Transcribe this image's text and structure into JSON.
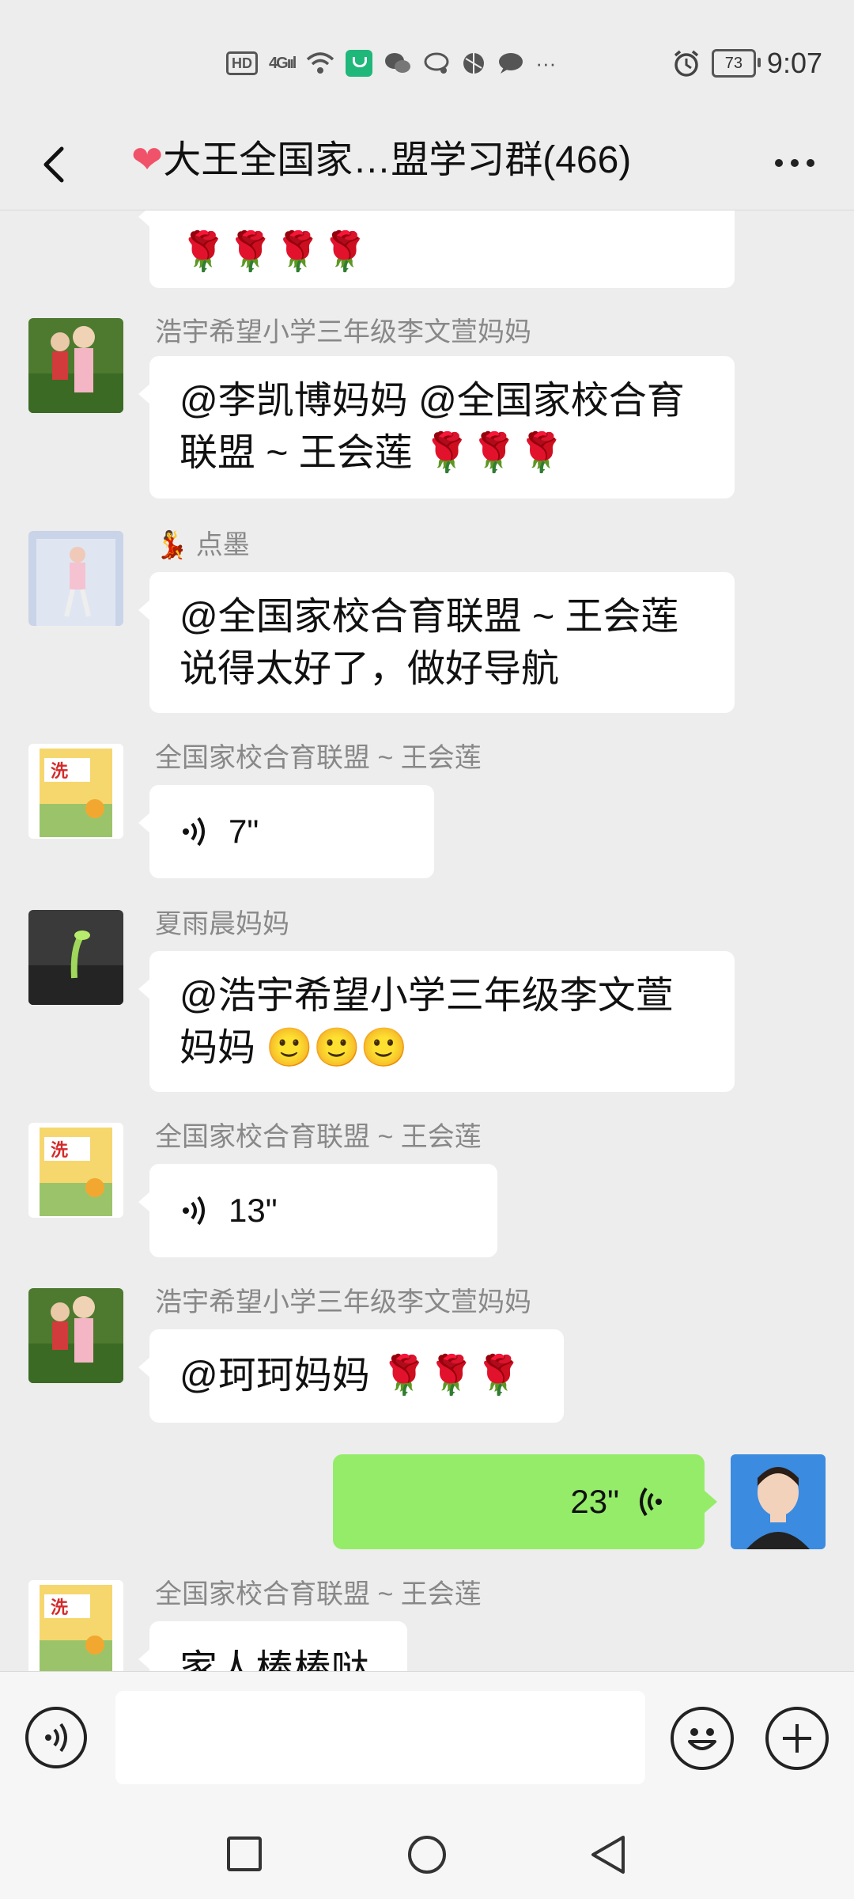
{
  "status_bar": {
    "hd": "HD",
    "network": "4G",
    "signal": "ııl",
    "battery": "73",
    "time": "9:07",
    "more": "···"
  },
  "header": {
    "title": "大王全国家…盟学习群(466)",
    "heart_icon": "heart-emoji"
  },
  "messages": [
    {
      "type": "text-partial",
      "content": "🌹🌹🌹🌹"
    },
    {
      "type": "text",
      "sender": "浩宇希望小学三年级李文萱妈妈",
      "line1": "@李凯博妈妈 @全国家校合育",
      "line2": "联盟 ~ 王会莲 🌹🌹🌹"
    },
    {
      "type": "text",
      "sender": "点墨",
      "sender_badge": "💃",
      "line1": "@全国家校合育联盟 ~ 王会莲",
      "line2": "说得太好了，做好导航"
    },
    {
      "type": "voice",
      "sender": "全国家校合育联盟 ~ 王会莲",
      "duration": "7\""
    },
    {
      "type": "text",
      "sender": "夏雨晨妈妈",
      "line1": "@浩宇希望小学三年级李文萱",
      "line2": "妈妈 🙂🙂🙂"
    },
    {
      "type": "voice",
      "sender": "全国家校合育联盟 ~ 王会莲",
      "duration": "13\""
    },
    {
      "type": "text",
      "sender": "浩宇希望小学三年级李文萱妈妈",
      "line1": "@珂珂妈妈 🌹🌹🌹"
    },
    {
      "type": "voice-self",
      "duration": "23\""
    },
    {
      "type": "text-partial",
      "sender": "全国家校合育联盟 ~ 王会莲",
      "line1": "家人棒棒哒"
    }
  ],
  "input": {
    "placeholder": ""
  },
  "accent_colors": {
    "self_bubble": "#95ec69",
    "background": "#ededed"
  }
}
